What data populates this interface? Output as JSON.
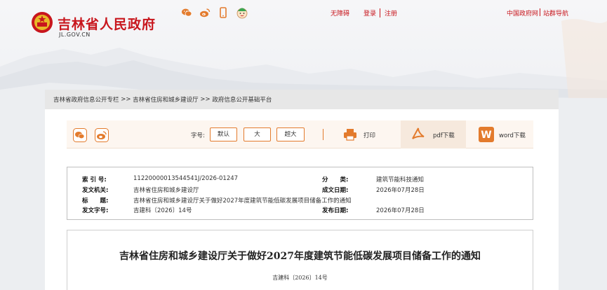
{
  "header": {
    "site_title": "吉林省人民政府",
    "site_domain": "JL.GOV.CN",
    "social_icons": [
      "wechat-icon",
      "weibo-icon",
      "mobile-icon",
      "mascot-icon"
    ],
    "links": {
      "accessibility": "无障碍",
      "login": "登录",
      "register": "注册",
      "gov_china": "中国政府网",
      "site_nav": "站群导航"
    },
    "accent_color": "#c8161d"
  },
  "breadcrumb": {
    "items": [
      "吉林省政府信息公开专栏",
      "吉林省住房和城乡建设厅",
      "政府信息公开基础平台"
    ],
    "separator": ">>"
  },
  "toolbar": {
    "font_size_label": "字号:",
    "font_default": "默认",
    "font_large": "大",
    "font_xlarge": "超大",
    "print_label": "打印",
    "pdf_label": "pdf下载",
    "word_label": "word下载",
    "accent_color": "#e37b2d"
  },
  "meta": {
    "index_no_label": "索 引 号:",
    "index_no": "11220000013544541J/2026-01247",
    "category_label": "分　　类:",
    "category": "建筑节能科技通知",
    "issuer_label": "发文机关:",
    "issuer": "吉林省住房和城乡建设厅",
    "created_label": "成文日期:",
    "created": "2026年07月28日",
    "title_label": "标　　题:",
    "title": "吉林省住房和城乡建设厅关于做好2027年度建筑节能低碳发展项目储备工作的通知",
    "doc_no_label": "发文字号:",
    "doc_no": "吉建科〔2026〕14号",
    "published_label": "发布日期:",
    "published": "2026年07月28日"
  },
  "document": {
    "title": "吉林省住房和城乡建设厅关于做好2027年度建筑节能低碳发展项目储备工作的通知",
    "doc_no": "吉建科〔2026〕14号"
  }
}
